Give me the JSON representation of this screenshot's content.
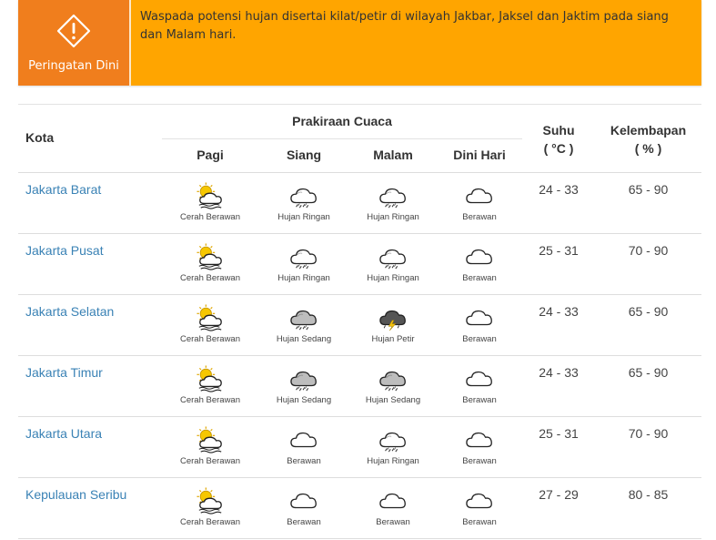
{
  "alert": {
    "badge_label": "Peringatan Dini",
    "badge_icon": "warning-icon",
    "message": "Waspada potensi hujan disertai kilat/petir di wilayah Jakbar, Jaksel dan Jaktim pada siang dan Malam hari."
  },
  "table": {
    "headers": {
      "kota": "Kota",
      "prakiraan": "Prakiraan Cuaca",
      "periods": [
        "Pagi",
        "Siang",
        "Malam",
        "Dini Hari"
      ],
      "suhu": "Suhu",
      "suhu_unit": "( °C )",
      "kelembapan": "Kelembapan",
      "kelembapan_unit": "( % )"
    },
    "rows": [
      {
        "city": "Jakarta Barat",
        "forecast": [
          {
            "icon": "partly-cloudy-sun-icon",
            "label": "Cerah Berawan"
          },
          {
            "icon": "light-rain-icon",
            "label": "Hujan Ringan"
          },
          {
            "icon": "light-rain-icon",
            "label": "Hujan Ringan"
          },
          {
            "icon": "cloud-icon",
            "label": "Berawan"
          }
        ],
        "suhu": "24 - 33",
        "kelembapan": "65 - 90"
      },
      {
        "city": "Jakarta Pusat",
        "forecast": [
          {
            "icon": "partly-cloudy-sun-icon",
            "label": "Cerah Berawan"
          },
          {
            "icon": "light-rain-icon",
            "label": "Hujan Ringan"
          },
          {
            "icon": "light-rain-icon",
            "label": "Hujan Ringan"
          },
          {
            "icon": "cloud-icon",
            "label": "Berawan"
          }
        ],
        "suhu": "25 - 31",
        "kelembapan": "70 - 90"
      },
      {
        "city": "Jakarta Selatan",
        "forecast": [
          {
            "icon": "partly-cloudy-sun-icon",
            "label": "Cerah Berawan"
          },
          {
            "icon": "moderate-rain-icon",
            "label": "Hujan Sedang"
          },
          {
            "icon": "thunderstorm-icon",
            "label": "Hujan Petir"
          },
          {
            "icon": "cloud-icon",
            "label": "Berawan"
          }
        ],
        "suhu": "24 - 33",
        "kelembapan": "65 - 90"
      },
      {
        "city": "Jakarta Timur",
        "forecast": [
          {
            "icon": "partly-cloudy-sun-icon",
            "label": "Cerah Berawan"
          },
          {
            "icon": "moderate-rain-icon",
            "label": "Hujan Sedang"
          },
          {
            "icon": "moderate-rain-icon",
            "label": "Hujan Sedang"
          },
          {
            "icon": "cloud-icon",
            "label": "Berawan"
          }
        ],
        "suhu": "24 - 33",
        "kelembapan": "65 - 90"
      },
      {
        "city": "Jakarta Utara",
        "forecast": [
          {
            "icon": "partly-cloudy-sun-icon",
            "label": "Cerah Berawan"
          },
          {
            "icon": "cloud-icon",
            "label": "Berawan"
          },
          {
            "icon": "light-rain-icon",
            "label": "Hujan Ringan"
          },
          {
            "icon": "cloud-icon",
            "label": "Berawan"
          }
        ],
        "suhu": "25 - 31",
        "kelembapan": "70 - 90"
      },
      {
        "city": "Kepulauan Seribu",
        "forecast": [
          {
            "icon": "partly-cloudy-sun-icon",
            "label": "Cerah Berawan"
          },
          {
            "icon": "cloud-icon",
            "label": "Berawan"
          },
          {
            "icon": "cloud-icon",
            "label": "Berawan"
          },
          {
            "icon": "cloud-icon",
            "label": "Berawan"
          }
        ],
        "suhu": "27 - 29",
        "kelembapan": "80 - 85"
      }
    ]
  },
  "colors": {
    "badge": "#f07e1d",
    "alert": "#ffa500",
    "link": "#3a82b5"
  }
}
